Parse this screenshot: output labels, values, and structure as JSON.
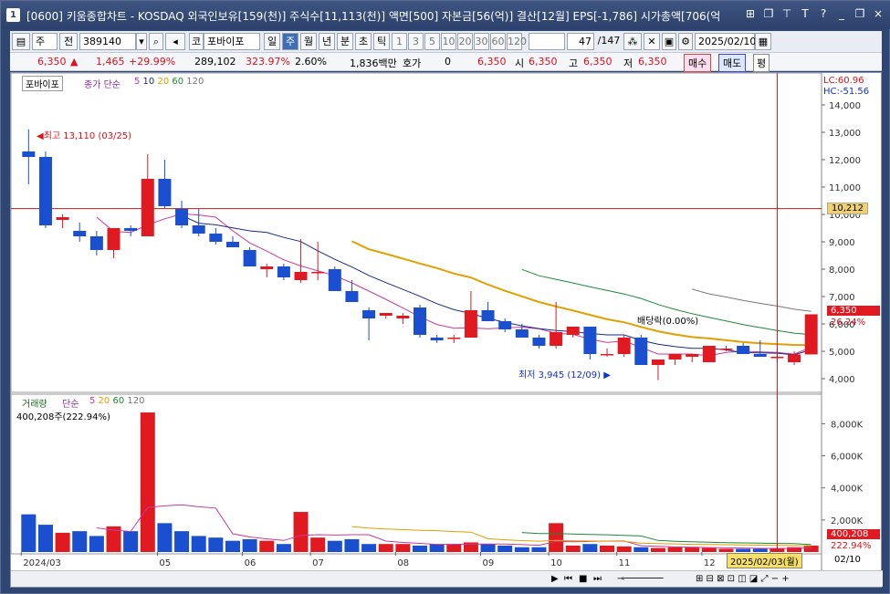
{
  "titlebar": {
    "window_num": "1",
    "title": "[0600] 키움종합차트 - KOSDAQ 외국인보유[159(천)] 주식수[11,113(천)] 액면[500] 자본금[56(억)] 결산[12월] EPS[-1,786] 시가총액[706(억",
    "buttons": [
      "⊞",
      "❐",
      "⊤",
      "T",
      "?",
      "_",
      "❐",
      "×"
    ]
  },
  "toolbar": {
    "period_sel": "주",
    "prev_label": "전",
    "code": "389140",
    "stock_prefix": "코",
    "stock_name": "포바이포",
    "intervals": [
      "일",
      "주",
      "월",
      "년",
      "분",
      "초",
      "틱"
    ],
    "active_interval": "주",
    "minute_opts": [
      "1",
      "3",
      "5",
      "10",
      "20",
      "30",
      "60",
      "120"
    ],
    "count": "47",
    "count_total": "/147",
    "date": "2025/02/10"
  },
  "quote": {
    "price": "6,350",
    "change": "1,465",
    "change_pct": "+29.99%",
    "volume": "289,102",
    "vol_pct": "323.97%",
    "turnover": "2.60%",
    "amount": "1,836백만",
    "hoga_label": "호가",
    "hoga_val": "0",
    "hoga_price": "6,350",
    "open_label": "시",
    "open": "6,350",
    "high_label": "고",
    "high": "6,350",
    "low_label": "저",
    "low": "6,350",
    "buy_label": "매수",
    "sell_label": "매도",
    "avg_label": "평"
  },
  "price_panel": {
    "name_label": "포바이포",
    "ma_label": "종가 단순",
    "ma_periods": [
      "5",
      "10",
      "20",
      "60",
      "120"
    ],
    "lc": "LC:60.96",
    "hc": "HC:-51.56",
    "high_note": "최고 13,110 (03/25)",
    "low_note": "최저 3,945 (12/09)",
    "div_note": "배당락(0.00%)",
    "hline_value": "10,212",
    "last_price": "6,350",
    "last_pct": "26.24%",
    "y_ticks": [
      "14,000",
      "13,000",
      "12,000",
      "11,000",
      "10,000",
      "9,000",
      "8,000",
      "7,000",
      "6,000",
      "5,000",
      "4,000"
    ]
  },
  "volume_panel": {
    "name_label": "거래량",
    "ma_label": "단순",
    "ma_periods": [
      "5",
      "20",
      "60",
      "120"
    ],
    "info": "400,208주(222.94%)",
    "y_ticks": [
      "8,000K",
      "6,000K",
      "4,000K",
      "2,000K"
    ],
    "last_vol": "400,208",
    "last_pct": "222.94%"
  },
  "x_axis": {
    "labels": [
      "2024/03",
      "05",
      "06",
      "07",
      "08",
      "09",
      "10",
      "11",
      "12",
      "2025/"
    ],
    "cursor_date": "2025/02/03(월)",
    "end_label": "02/10"
  },
  "chart_data": {
    "type": "candlestick",
    "series": [
      {
        "name": "price",
        "ohlc": [
          [
            12300,
            13110,
            11100,
            12100
          ],
          [
            12100,
            12300,
            9500,
            9600
          ],
          [
            9800,
            10000,
            9500,
            9900
          ],
          [
            9400,
            9700,
            9000,
            9200
          ],
          [
            9200,
            9400,
            8500,
            8700
          ],
          [
            8700,
            9500,
            8400,
            9500
          ],
          [
            9500,
            9600,
            9200,
            9400
          ],
          [
            9200,
            12200,
            9200,
            11300
          ],
          [
            11300,
            12000,
            10200,
            10300
          ],
          [
            10200,
            10500,
            9500,
            9600
          ],
          [
            9600,
            10200,
            9200,
            9300
          ],
          [
            9300,
            9500,
            8900,
            9000
          ],
          [
            9000,
            9200,
            8800,
            8800
          ],
          [
            8700,
            8800,
            8100,
            8100
          ],
          [
            8000,
            8200,
            7700,
            8100
          ],
          [
            8100,
            8200,
            7600,
            7700
          ],
          [
            7600,
            9100,
            7500,
            7900
          ],
          [
            7900,
            9000,
            7600,
            7900
          ],
          [
            8000,
            8100,
            7200,
            7200
          ],
          [
            7200,
            7600,
            6800,
            6800
          ],
          [
            6500,
            6600,
            5400,
            6200
          ],
          [
            6300,
            6400,
            6200,
            6400
          ],
          [
            6200,
            6400,
            6000,
            6300
          ],
          [
            6600,
            6700,
            5500,
            5600
          ],
          [
            5500,
            5600,
            5300,
            5400
          ],
          [
            5500,
            5600,
            5300,
            5500
          ],
          [
            5500,
            7200,
            5500,
            6500
          ],
          [
            6500,
            6800,
            6100,
            6100
          ],
          [
            6100,
            6200,
            5700,
            5800
          ],
          [
            5800,
            6000,
            5500,
            5500
          ],
          [
            5500,
            5600,
            5100,
            5200
          ],
          [
            5200,
            6800,
            5100,
            5700
          ],
          [
            5600,
            5900,
            5500,
            5900
          ],
          [
            5900,
            5900,
            4700,
            4900
          ],
          [
            4900,
            5100,
            4800,
            4900
          ],
          [
            4900,
            5600,
            4800,
            5500
          ],
          [
            5500,
            5600,
            4500,
            4500
          ],
          [
            4500,
            4700,
            3945,
            4700
          ],
          [
            4700,
            4900,
            4500,
            4900
          ],
          [
            4800,
            4900,
            4600,
            4900
          ],
          [
            4600,
            5200,
            4600,
            5200
          ],
          [
            5100,
            5200,
            5000,
            5100
          ],
          [
            5200,
            5300,
            4900,
            4900
          ],
          [
            4900,
            5400,
            4800,
            4800
          ],
          [
            4800,
            5100,
            4600,
            4800
          ],
          [
            4600,
            5000,
            4500,
            4885
          ],
          [
            4885,
            6350,
            4885,
            6350
          ]
        ]
      },
      {
        "name": "volume",
        "values": [
          2350,
          1700,
          1200,
          1300,
          1000,
          1600,
          1300,
          8700,
          1800,
          1300,
          1000,
          900,
          700,
          800,
          700,
          500,
          2500,
          900,
          700,
          800,
          500,
          500,
          500,
          400,
          500,
          500,
          600,
          500,
          400,
          300,
          300,
          1800,
          400,
          500,
          400,
          350,
          300,
          250,
          300,
          300,
          250,
          200,
          200,
          200,
          250,
          300,
          400
        ]
      }
    ],
    "y_range": [
      3500,
      15000
    ],
    "vol_range": [
      0,
      9500
    ],
    "hline": 10212
  }
}
